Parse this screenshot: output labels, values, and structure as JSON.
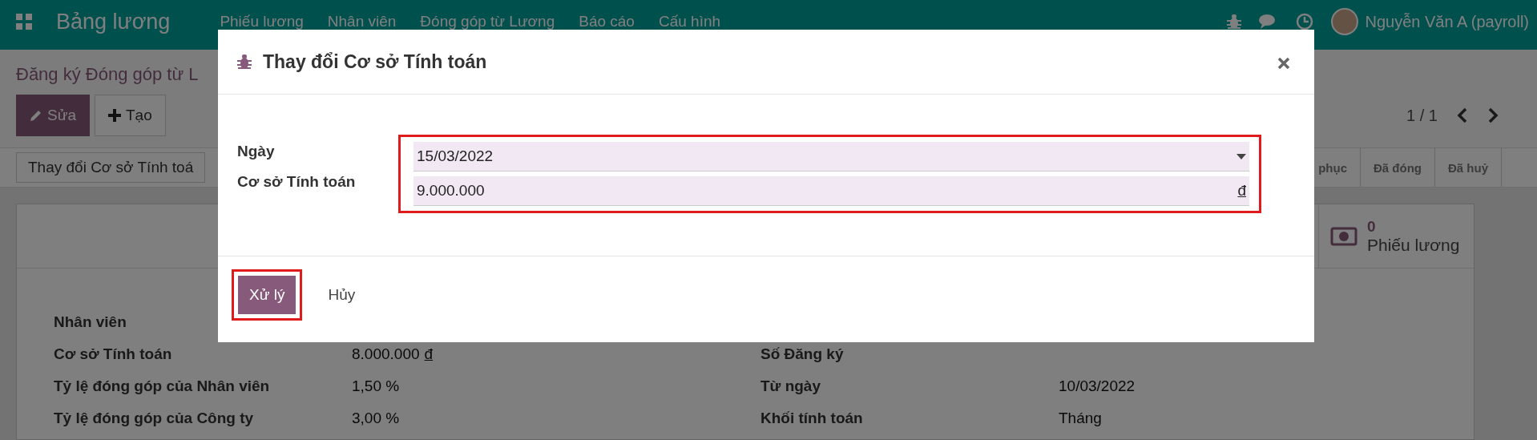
{
  "navbar": {
    "app_title": "Bảng lương",
    "menu": [
      "Phiếu lương",
      "Nhân viên",
      "Đóng góp từ Lương",
      "Báo cáo",
      "Cấu hình"
    ],
    "user": "Nguyễn Văn A (payroll)"
  },
  "breadcrumb": "Đăng ký Đóng góp từ L",
  "buttons": [
    {
      "label": "Sửa",
      "kind": "primary"
    },
    {
      "label": "Tạo",
      "kind": "secondary"
    }
  ],
  "pager": "1 / 1",
  "action_button": "Thay đổi Cơ sở Tính toá",
  "status_stages": [
    {
      "label": "phục",
      "selected": false
    },
    {
      "label": "Đã đóng",
      "selected": false
    },
    {
      "label": "Đã huỷ",
      "selected": false
    }
  ],
  "smart_button": {
    "count": "0",
    "label": "Phiếu lương"
  },
  "fields_left": [
    {
      "label": "Nhân viên"
    },
    {
      "label": "Cơ sở Tính toán",
      "value": "8.000.000",
      "currency": "đ"
    },
    {
      "label": "Tỷ lệ đóng góp của Nhân viên",
      "value": "1,50 %"
    },
    {
      "label": "Tỷ lệ đóng góp của Công ty",
      "value": "3,00 %"
    }
  ],
  "fields_right": [
    {
      "label": "Số Đăng ký"
    },
    {
      "label": "Từ ngày",
      "value": "10/03/2022"
    },
    {
      "label": "Khối tính toán",
      "value": "Tháng"
    }
  ],
  "dialog": {
    "title": "Thay đổi Cơ sở Tính toán",
    "fields_highlighted": true,
    "fields": [
      {
        "label": "Ngày",
        "value": "15/03/2022",
        "kind": "date"
      },
      {
        "label": "Cơ sở Tính toán",
        "value": "9.000.000",
        "kind": "monetary",
        "currency": "đ"
      }
    ],
    "buttons": [
      {
        "label": "Xử lý",
        "kind": "primary",
        "highlighted": true
      },
      {
        "label": "Hủy",
        "kind": "link",
        "highlighted": false
      }
    ]
  }
}
